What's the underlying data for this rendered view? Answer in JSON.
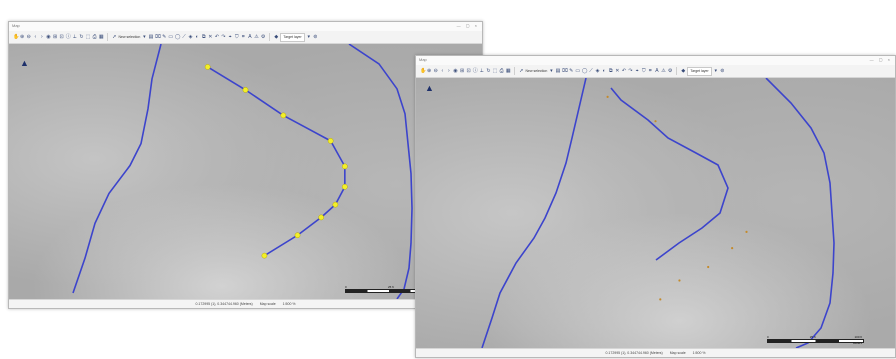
{
  "colors": {
    "line": "#3c44cc",
    "vertex": "#f2ef2a",
    "vertex_stroke": "#b9a900",
    "orange_point": "#c48a2a"
  },
  "toolbar": {
    "selection_label": "New selection",
    "layer_label": "Target layer"
  },
  "windows": [
    {
      "id": "left",
      "title": "Map",
      "controls": "— ▢ ×",
      "north": "▲",
      "status": {
        "coords": "0.172995 (1), 0.344744.960 (Meters)",
        "scale_label": "Map scale",
        "scale_value": "1:500 %"
      },
      "scalebar": {
        "left": "0",
        "mid": "25 ft",
        "unit": ""
      }
    },
    {
      "id": "right",
      "title": "Map",
      "controls": "— ▢ ×",
      "north": "▲",
      "status": {
        "coords": "0.172995 (1), 0.344744.960 (Meters)",
        "scale_label": "Map scale",
        "scale_value": "1:500 %"
      },
      "scalebar": {
        "left": "0",
        "mid": "25 ft",
        "right": "100 ft",
        "unit": "Meters"
      }
    }
  ],
  "left_vertices": [
    [
      0.42,
      0.09
    ],
    [
      0.5,
      0.18
    ],
    [
      0.58,
      0.28
    ],
    [
      0.68,
      0.38
    ],
    [
      0.71,
      0.48
    ],
    [
      0.71,
      0.56
    ],
    [
      0.69,
      0.63
    ],
    [
      0.66,
      0.68
    ],
    [
      0.61,
      0.75
    ],
    [
      0.54,
      0.83
    ]
  ],
  "right_points": [
    [
      0.4,
      0.07
    ],
    [
      0.5,
      0.16
    ],
    [
      0.69,
      0.57
    ],
    [
      0.66,
      0.63
    ],
    [
      0.61,
      0.7
    ],
    [
      0.55,
      0.75
    ],
    [
      0.51,
      0.82
    ]
  ]
}
